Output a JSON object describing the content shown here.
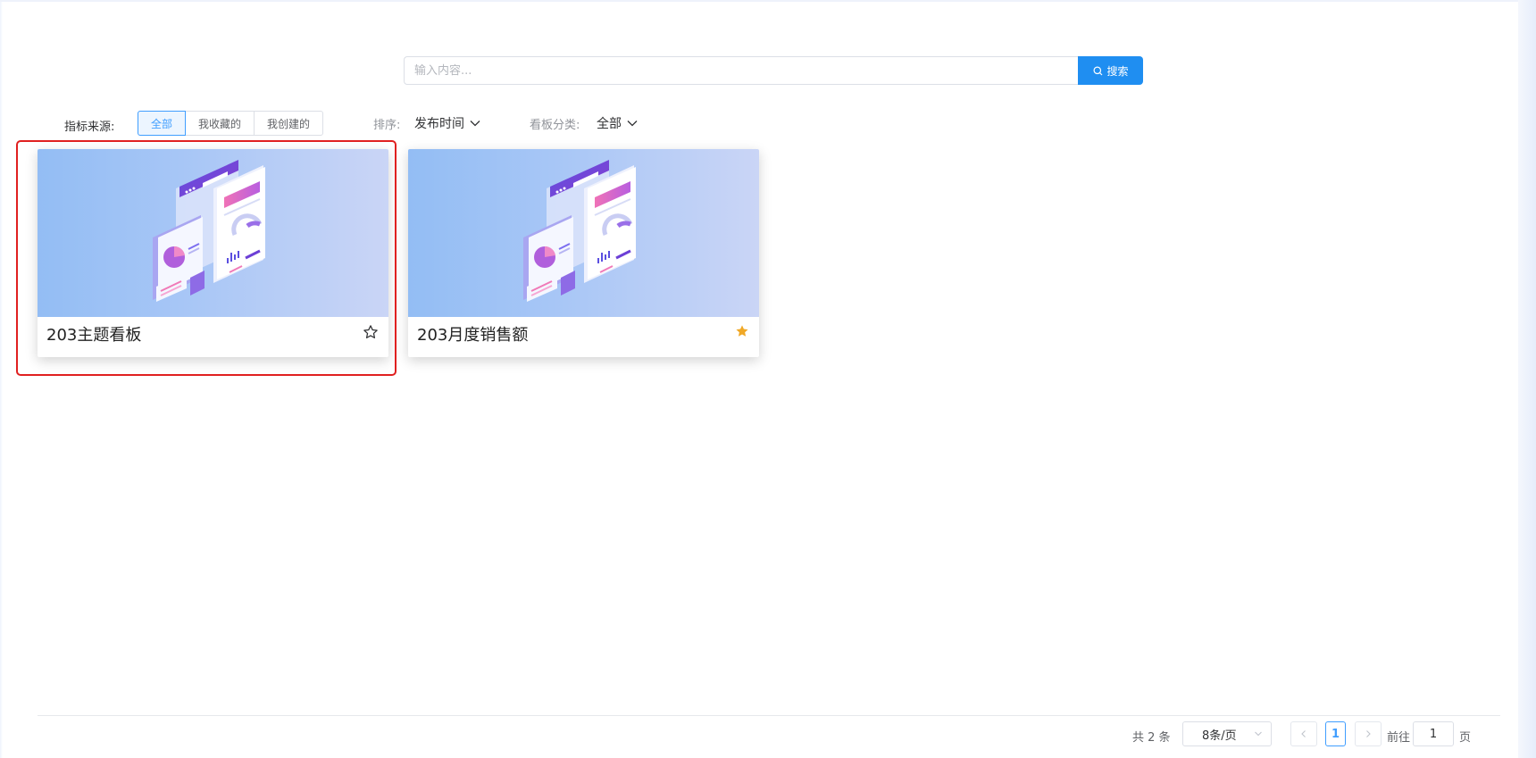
{
  "search": {
    "placeholder": "输入内容...",
    "button_label": "搜索"
  },
  "filters": {
    "source_label": "指标来源:",
    "source_options": [
      "全部",
      "我收藏的",
      "我创建的"
    ],
    "source_selected": "全部",
    "sort_label": "排序:",
    "sort_value": "发布时间",
    "category_label": "看板分类:",
    "category_value": "全部"
  },
  "cards": [
    {
      "title": "203主题看板",
      "favorited": false
    },
    {
      "title": "203月度销售额",
      "favorited": true
    }
  ],
  "pagination": {
    "total_text": "共 2 条",
    "page_size": "8条/页",
    "current_page": "1",
    "goto_label": "前往",
    "goto_value": "1",
    "page_suffix": "页"
  },
  "colors": {
    "accent": "#1f8ef1",
    "star_filled": "#f0a826",
    "highlight_border": "#e02020"
  }
}
